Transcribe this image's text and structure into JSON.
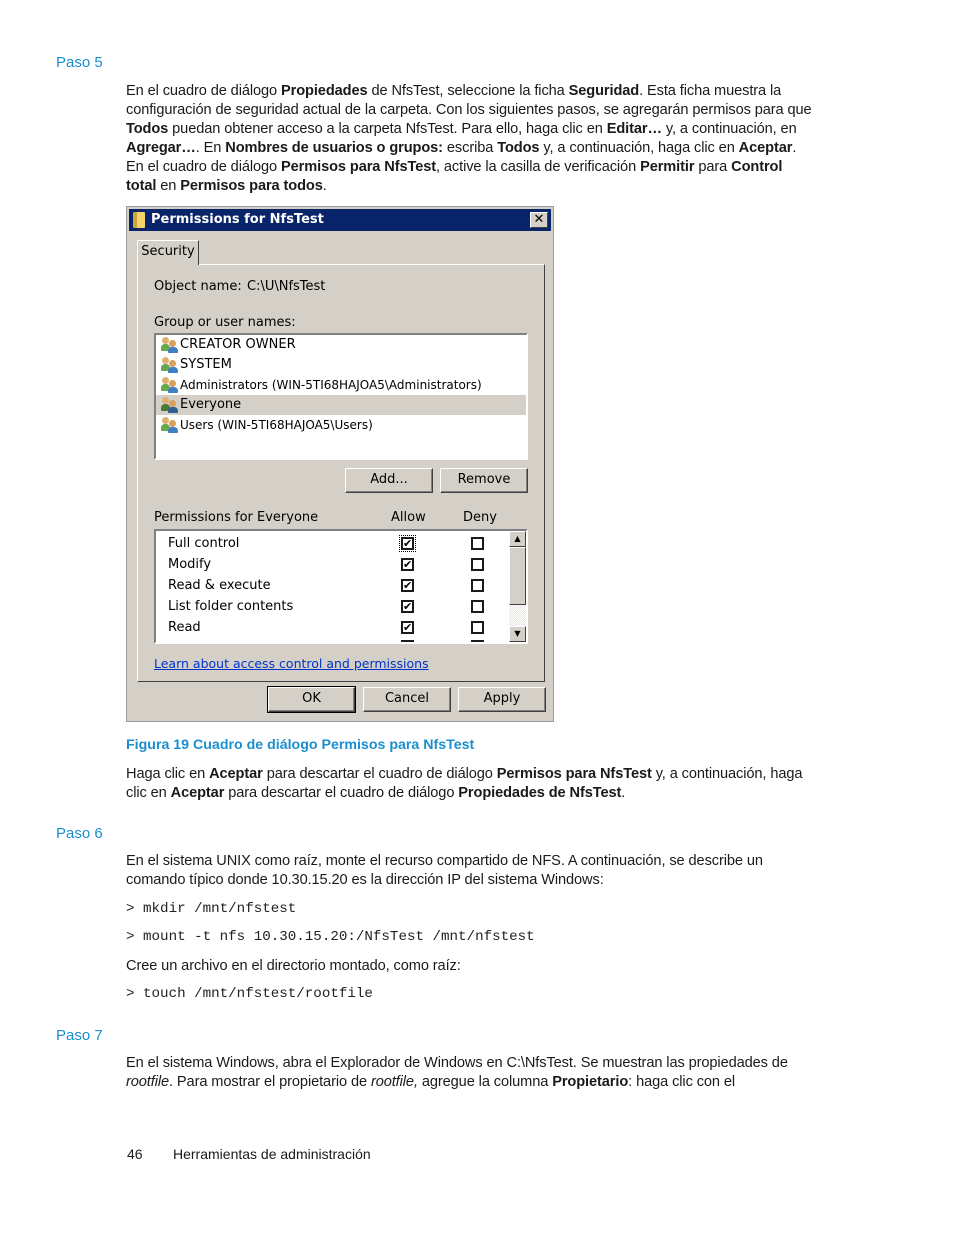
{
  "page": {
    "steps": [
      {
        "heading": "Paso 5"
      },
      {
        "heading": "Paso 6"
      },
      {
        "heading": "Paso 7"
      }
    ],
    "paso5": {
      "t1": "En el cuadro de diálogo ",
      "b1": "Propiedades",
      "t2": " de NfsTest, seleccione la ficha ",
      "b2": "Seguridad",
      "t3": ". Esta ficha muestra la configuración de seguridad actual de la carpeta. Con los siguientes pasos, se agregarán permisos para que ",
      "b3": "Todos",
      "t4": " puedan obtener acceso a la carpeta NfsTest. Para ello, haga clic en ",
      "b4": "Editar…",
      "t5": " y, a continuación, en ",
      "b5": "Agregar…",
      "t6": ". En ",
      "b6": "Nombres de usuarios o grupos:",
      "t7": " escriba ",
      "b7": "Todos",
      "t8": " y, a continuación, haga clic en ",
      "b8": "Aceptar",
      "t9": ". En el cuadro de diálogo ",
      "b9": "Permisos para NfsTest",
      "t10": ", active la casilla de verificación ",
      "b10": "Permitir",
      "t11": " para ",
      "b11": "Control total",
      "t12": " en ",
      "b12": "Permisos para todos",
      "t13": "."
    },
    "caption": "Figura 19 Cuadro de diálogo Permisos para NfsTest",
    "after_fig": {
      "t1": "Haga clic en ",
      "b1": "Aceptar",
      "t2": " para descartar el cuadro de diálogo ",
      "b2": "Permisos para NfsTest",
      "t3": " y, a continuación, haga clic en ",
      "b3": "Aceptar",
      "t4": " para descartar el cuadro de diálogo ",
      "b4": "Propiedades de NfsTest",
      "t5": "."
    },
    "paso6": {
      "intro": "En el sistema UNIX como raíz, monte el recurso compartido de NFS. A continuación, se describe un comando típico donde 10.30.15.20 es la dirección IP del sistema Windows:",
      "cmd1": "> mkdir /mnt/nfstest",
      "cmd2": "> mount -t nfs 10.30.15.20:/NfsTest /mnt/nfstest",
      "create": "Cree un archivo en el directorio montado, como raíz:",
      "cmd3": "> touch /mnt/nfstest/rootfile"
    },
    "paso7": {
      "t1": "En el sistema Windows, abra el Explorador de Windows en C:\\NfsTest. Se muestran las propiedades de ",
      "i1": "rootfile",
      "t2": ". Para mostrar el propietario de ",
      "i2": "rootfile,",
      "t3": " agregue la columna ",
      "b1": "Propietario",
      "t4": ": haga clic con el"
    },
    "footer": {
      "page_number": "46",
      "section": "Herramientas de administración"
    }
  },
  "dialog": {
    "title": "Permissions for NfsTest",
    "close_label": "✕",
    "tab": "Security",
    "object_name_label": "Object name:",
    "object_name_value": "C:\\U\\NfsTest",
    "group_label": "Group or user names:",
    "users": [
      {
        "name": "CREATOR OWNER",
        "selected": false
      },
      {
        "name": "SYSTEM",
        "selected": false
      },
      {
        "name": "Administrators (WIN-5TI68HAJOA5\\Administrators)",
        "selected": false
      },
      {
        "name": "Everyone",
        "selected": true
      },
      {
        "name": "Users (WIN-5TI68HAJOA5\\Users)",
        "selected": false
      }
    ],
    "add_button": "Add...",
    "remove_button": "Remove",
    "permissions_label": "Permissions for Everyone",
    "allow_header": "Allow",
    "deny_header": "Deny",
    "permissions": [
      {
        "name": "Full control",
        "allow": true,
        "deny": false
      },
      {
        "name": "Modify",
        "allow": true,
        "deny": false
      },
      {
        "name": "Read & execute",
        "allow": true,
        "deny": false
      },
      {
        "name": "List folder contents",
        "allow": true,
        "deny": false
      },
      {
        "name": "Read",
        "allow": true,
        "deny": false
      }
    ],
    "check_glyph": "✔",
    "learn_link": "Learn about access control and permissions",
    "ok_button": "OK",
    "cancel_button": "Cancel",
    "apply_button": "Apply"
  }
}
